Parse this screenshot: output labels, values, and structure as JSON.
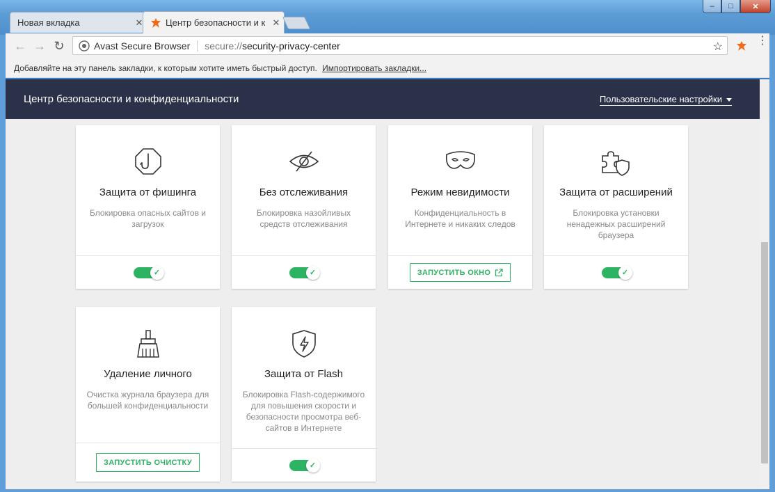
{
  "window": {
    "controls": {
      "minimize": "–",
      "maximize": "□",
      "close": "✕"
    }
  },
  "tabs": [
    {
      "title": "Новая вкладка",
      "close": "✕"
    },
    {
      "title": "Центр безопасности и к",
      "close": "✕"
    }
  ],
  "toolbar": {
    "site_name": "Avast Secure Browser",
    "url_scheme": "secure://",
    "url_path": "security-privacy-center",
    "back": "←",
    "forward": "→",
    "reload": "↻",
    "star": "☆",
    "menu": "⋮"
  },
  "bookmarks": {
    "hint": "Добавляйте на эту панель закладки, к которым хотите иметь быстрый доступ.",
    "import_link": "Импортировать закладки..."
  },
  "header": {
    "title": "Центр безопасности и конфиденциальности",
    "settings": "Пользовательские настройки"
  },
  "cards": [
    {
      "title": "Защита от фишинга",
      "desc": "Блокировка опасных сайтов и загрузок",
      "icon": "phishing-hook-icon",
      "control": "toggle",
      "enabled": true
    },
    {
      "title": "Без отслеживания",
      "desc": "Блокировка назойливых средств отслеживания",
      "icon": "eye-slash-icon",
      "control": "toggle",
      "enabled": true
    },
    {
      "title": "Режим невидимости",
      "desc": "Конфиденциальность в Интернете и никаких следов",
      "icon": "mask-icon",
      "control": "button",
      "button": "ЗАПУСТИТЬ ОКНО"
    },
    {
      "title": "Защита от расширений",
      "desc": "Блокировка установки ненадежных расширений браузера",
      "icon": "puzzle-shield-icon",
      "control": "toggle",
      "enabled": true
    },
    {
      "title": "Удаление личного",
      "desc": "Очистка журнала браузера для большей конфиденциальности",
      "icon": "brush-icon",
      "control": "button",
      "button": "ЗАПУСТИТЬ ОЧИСТКУ"
    },
    {
      "title": "Защита от Flash",
      "desc": "Блокировка Flash-содержимого для повышения скорости и безопасности просмотра веб-сайтов в Интернете",
      "icon": "flash-shield-icon",
      "control": "toggle",
      "enabled": true
    }
  ],
  "colors": {
    "accent": "#2db463",
    "header_bg": "#2b3148",
    "avast_orange": "#f26a1b"
  }
}
